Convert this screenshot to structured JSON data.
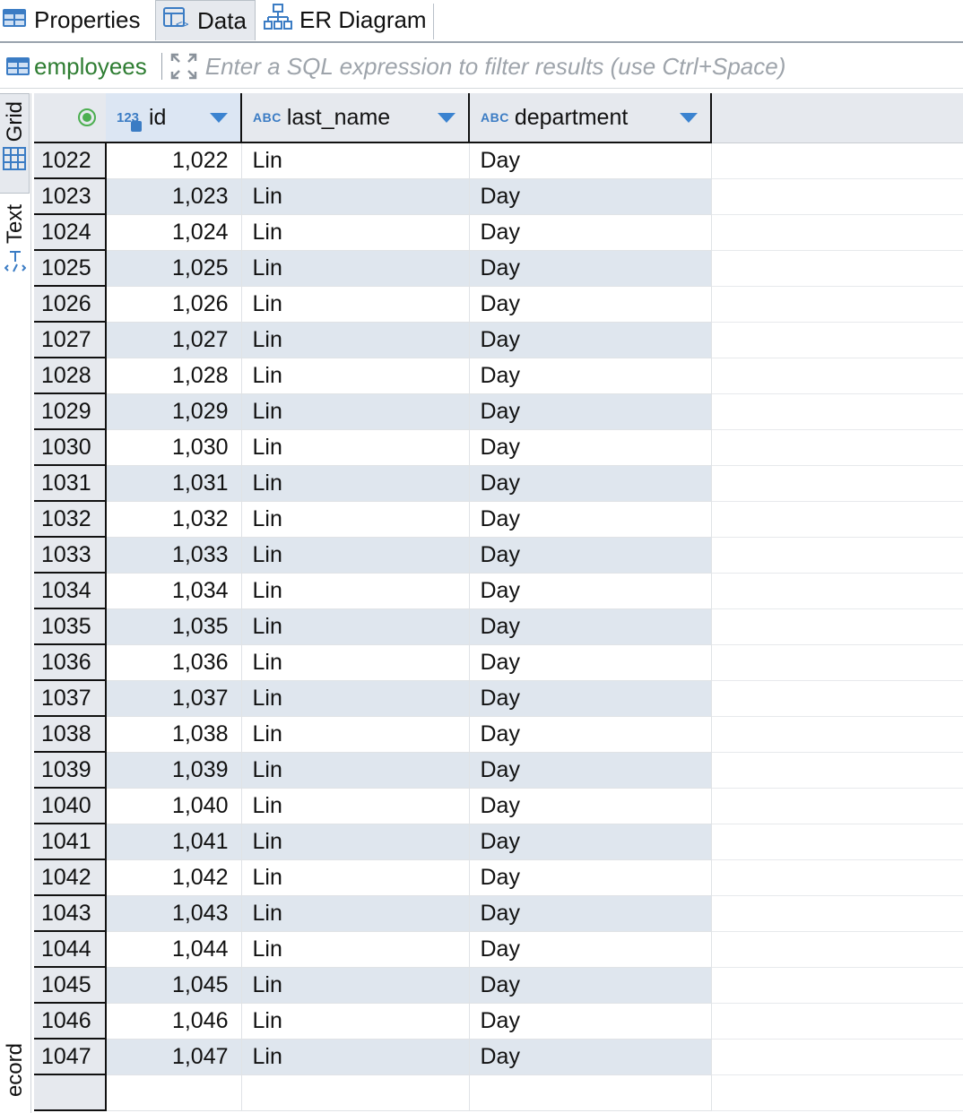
{
  "tabs": [
    {
      "label": "Properties",
      "icon": "table-icon",
      "active": false
    },
    {
      "label": "Data",
      "icon": "table-data-icon",
      "active": true
    },
    {
      "label": "ER Diagram",
      "icon": "er-diagram-icon",
      "active": false
    }
  ],
  "filter": {
    "table_name": "employees",
    "placeholder": "Enter a SQL expression to filter results (use Ctrl+Space)"
  },
  "side_tabs": {
    "grid": "Grid",
    "text": "Text",
    "record": "ecord"
  },
  "grid": {
    "columns": [
      {
        "name": "id",
        "type": "123"
      },
      {
        "name": "last_name",
        "type": "ABC"
      },
      {
        "name": "department",
        "type": "ABC"
      }
    ],
    "rows": [
      {
        "num": "1022",
        "id": "1,022",
        "last_name": "Lin",
        "department": "Day"
      },
      {
        "num": "1023",
        "id": "1,023",
        "last_name": "Lin",
        "department": "Day"
      },
      {
        "num": "1024",
        "id": "1,024",
        "last_name": "Lin",
        "department": "Day"
      },
      {
        "num": "1025",
        "id": "1,025",
        "last_name": "Lin",
        "department": "Day"
      },
      {
        "num": "1026",
        "id": "1,026",
        "last_name": "Lin",
        "department": "Day"
      },
      {
        "num": "1027",
        "id": "1,027",
        "last_name": "Lin",
        "department": "Day"
      },
      {
        "num": "1028",
        "id": "1,028",
        "last_name": "Lin",
        "department": "Day"
      },
      {
        "num": "1029",
        "id": "1,029",
        "last_name": "Lin",
        "department": "Day"
      },
      {
        "num": "1030",
        "id": "1,030",
        "last_name": "Lin",
        "department": "Day"
      },
      {
        "num": "1031",
        "id": "1,031",
        "last_name": "Lin",
        "department": "Day"
      },
      {
        "num": "1032",
        "id": "1,032",
        "last_name": "Lin",
        "department": "Day"
      },
      {
        "num": "1033",
        "id": "1,033",
        "last_name": "Lin",
        "department": "Day"
      },
      {
        "num": "1034",
        "id": "1,034",
        "last_name": "Lin",
        "department": "Day"
      },
      {
        "num": "1035",
        "id": "1,035",
        "last_name": "Lin",
        "department": "Day"
      },
      {
        "num": "1036",
        "id": "1,036",
        "last_name": "Lin",
        "department": "Day"
      },
      {
        "num": "1037",
        "id": "1,037",
        "last_name": "Lin",
        "department": "Day"
      },
      {
        "num": "1038",
        "id": "1,038",
        "last_name": "Lin",
        "department": "Day"
      },
      {
        "num": "1039",
        "id": "1,039",
        "last_name": "Lin",
        "department": "Day"
      },
      {
        "num": "1040",
        "id": "1,040",
        "last_name": "Lin",
        "department": "Day"
      },
      {
        "num": "1041",
        "id": "1,041",
        "last_name": "Lin",
        "department": "Day"
      },
      {
        "num": "1042",
        "id": "1,042",
        "last_name": "Lin",
        "department": "Day"
      },
      {
        "num": "1043",
        "id": "1,043",
        "last_name": "Lin",
        "department": "Day"
      },
      {
        "num": "1044",
        "id": "1,044",
        "last_name": "Lin",
        "department": "Day"
      },
      {
        "num": "1045",
        "id": "1,045",
        "last_name": "Lin",
        "department": "Day"
      },
      {
        "num": "1046",
        "id": "1,046",
        "last_name": "Lin",
        "department": "Day"
      },
      {
        "num": "1047",
        "id": "1,047",
        "last_name": "Lin",
        "department": "Day"
      }
    ]
  },
  "colors": {
    "accent": "#3b83d0",
    "table_name": "#2e7d32",
    "row_stripe": "#dfe6ee",
    "header_bg": "#e6e9ee"
  }
}
